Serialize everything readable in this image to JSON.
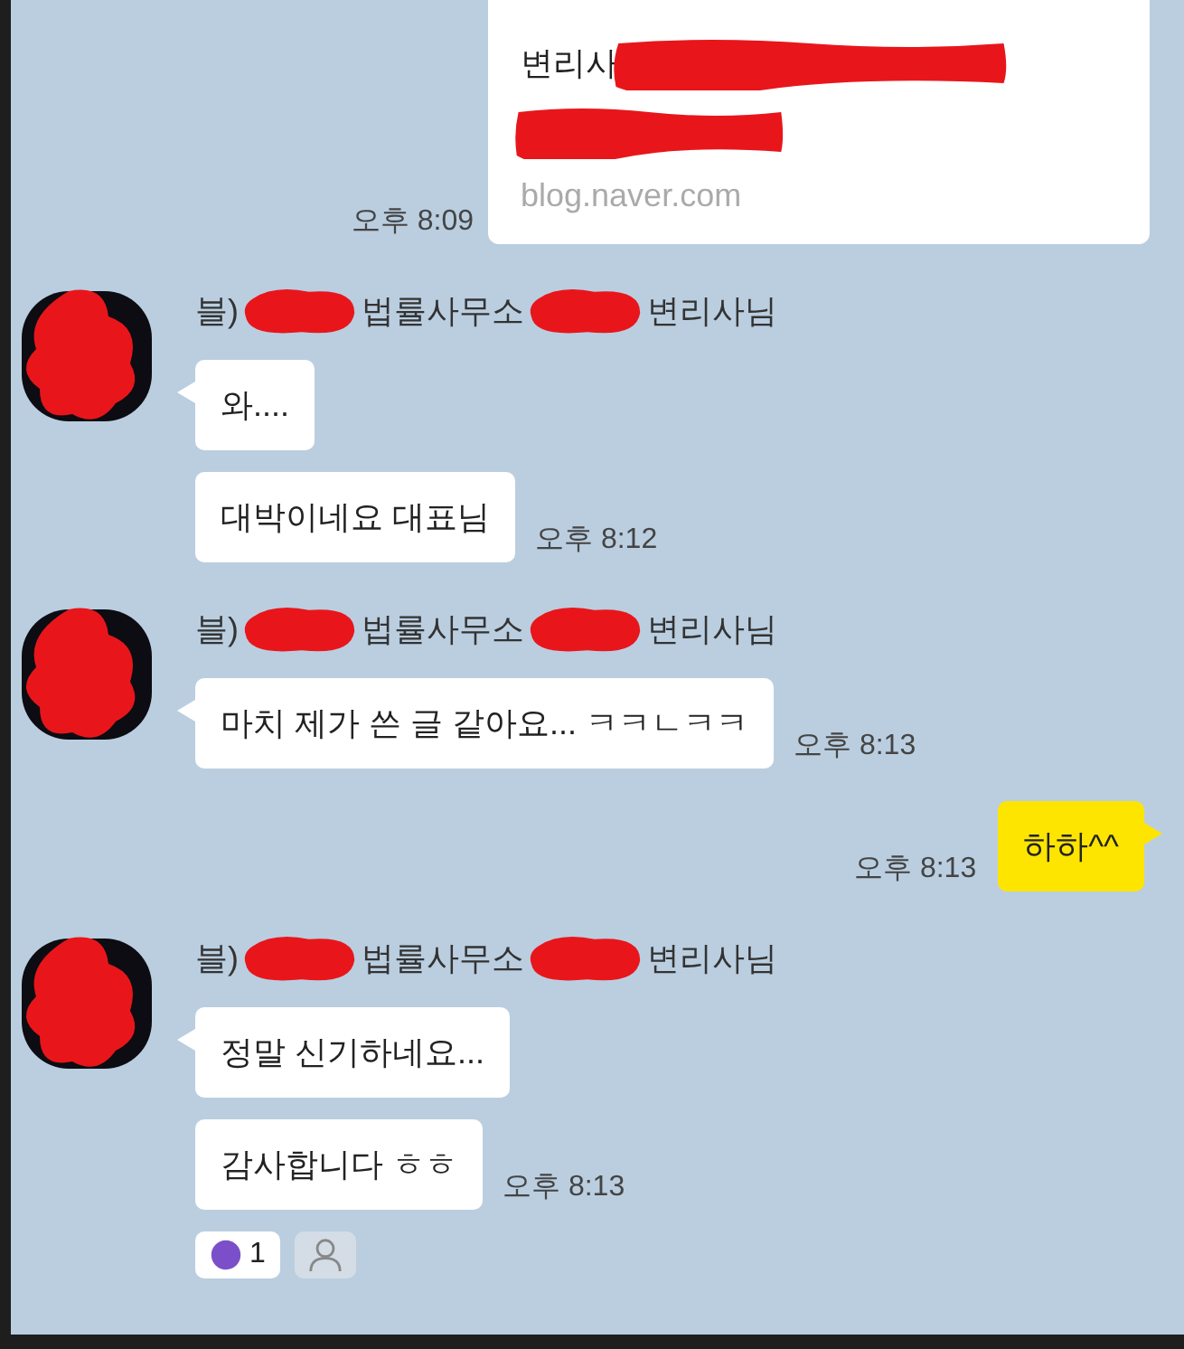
{
  "messages": [
    {
      "kind": "card",
      "lines": [
        [
          {
            "kind": "text",
            "text": "변리사"
          },
          {
            "kind": "redacted"
          }
        ],
        [
          {
            "kind": "redacted"
          }
        ]
      ],
      "domain": "blog.naver.com",
      "time": "오후 8:09"
    },
    {
      "kind": "incoming",
      "sender": [
        {
          "kind": "text",
          "text": "블)"
        },
        {
          "kind": "redacted"
        },
        {
          "kind": "text",
          "text": "법률사무소"
        },
        {
          "kind": "redacted"
        },
        {
          "kind": "text",
          "text": "변리사님"
        }
      ],
      "bubbles": [
        {
          "text": "와...."
        },
        {
          "text": "대박이네요 대표님",
          "time": "오후 8:12"
        }
      ]
    },
    {
      "kind": "incoming",
      "sender": [
        {
          "kind": "text",
          "text": "블)"
        },
        {
          "kind": "redacted"
        },
        {
          "kind": "text",
          "text": "법률사무소"
        },
        {
          "kind": "redacted"
        },
        {
          "kind": "text",
          "text": "변리사님"
        }
      ],
      "bubbles": [
        {
          "text": "마치 제가 쓴 글 같아요... ㅋㅋㄴㅋㅋ",
          "time": "오후 8:13"
        }
      ]
    },
    {
      "kind": "outgoing",
      "text": "하하^^",
      "time": "오후 8:13"
    },
    {
      "kind": "incoming",
      "sender": [
        {
          "kind": "text",
          "text": "블)"
        },
        {
          "kind": "redacted"
        },
        {
          "kind": "text",
          "text": "법률사무소"
        },
        {
          "kind": "redacted"
        },
        {
          "kind": "text",
          "text": "변리사님"
        }
      ],
      "bubbles": [
        {
          "text": "정말 신기하네요..."
        },
        {
          "text": "감사합니다 ㅎㅎ",
          "time": "오후 8:13"
        }
      ],
      "reactions": [
        {
          "kind": "like",
          "count": "1"
        },
        {
          "kind": "add"
        }
      ]
    }
  ]
}
